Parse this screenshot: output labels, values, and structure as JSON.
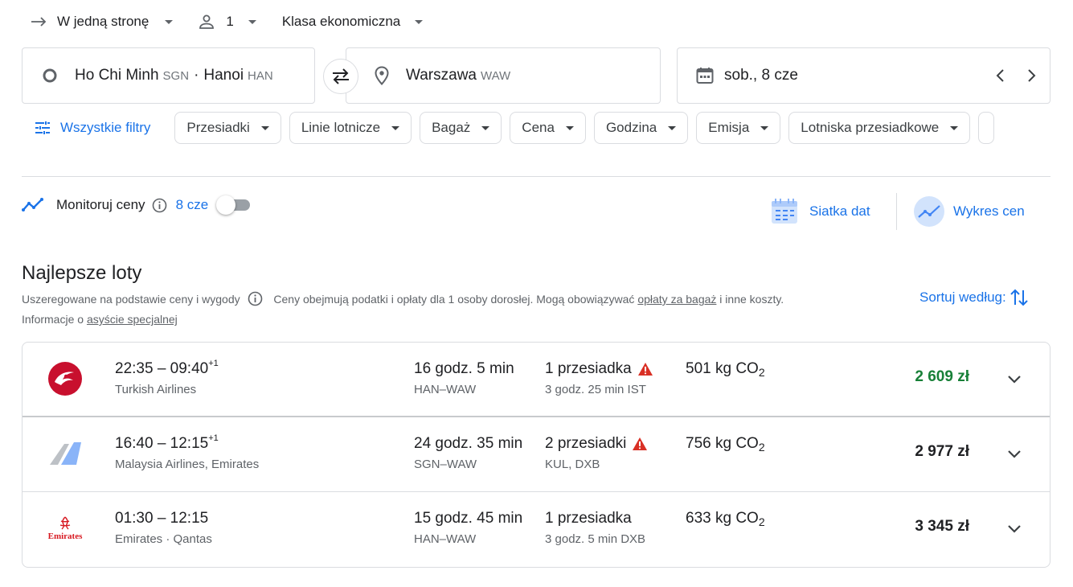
{
  "top": {
    "trip_type": "W jedną stronę",
    "passengers": "1",
    "cabin_class": "Klasa ekonomiczna"
  },
  "search": {
    "origin_city_1": "Ho Chi Minh",
    "origin_code_1": "SGN",
    "separator": "·",
    "origin_city_2": "Hanoi",
    "origin_code_2": "HAN",
    "destination_city": "Warszawa",
    "destination_code": "WAW",
    "date": "sob., 8 cze"
  },
  "filters": {
    "all_filters": "Wszystkie filtry",
    "chips": [
      "Przesiadki",
      "Linie lotnicze",
      "Bagaż",
      "Cena",
      "Godzina",
      "Emisja",
      "Lotniska przesiadkowe"
    ]
  },
  "monitor": {
    "label": "Monitoruj ceny",
    "date": "8 cze"
  },
  "views": {
    "date_grid": "Siatka dat",
    "price_graph": "Wykres cen"
  },
  "section": {
    "title": "Najlepsze loty",
    "ranked_by": "Uszeregowane na podstawie ceny i wygody",
    "prices_note_1": "Ceny obejmują podatki i opłaty dla 1 osoby dorosłej. Mogą obowiązywać",
    "baggage_link": "opłaty za bagaż",
    "prices_note_2": "i inne koszty.",
    "info_prefix": "Informacje o",
    "special_assistance_link": "asyście specjalnej",
    "sort_label": "Sortuj według:"
  },
  "flights": [
    {
      "times": "22:35 – 09:40",
      "day_offset": "+1",
      "airline": "Turkish Airlines",
      "duration": "16 godz. 5 min",
      "route": "HAN–WAW",
      "stops": "1 przesiadka",
      "stop_detail": "3 godz. 25 min IST",
      "co2_value": "501 kg CO",
      "co2_sub": "2",
      "price": "2 609 zł",
      "logo": "turkish-airlines-logo"
    },
    {
      "times": "16:40 – 12:15",
      "day_offset": "+1",
      "airline": "Malaysia Airlines, Emirates",
      "duration": "24 godz. 35 min",
      "route": "SGN–WAW",
      "stops": "2 przesiadki",
      "stop_detail": "KUL, DXB",
      "co2_value": "756 kg CO",
      "co2_sub": "2",
      "price": "2 977 zł",
      "logo": "multi-airline-logo"
    },
    {
      "times": "01:30 – 12:15",
      "day_offset": "",
      "airline": "Emirates · Qantas",
      "duration": "15 godz. 45 min",
      "route": "HAN–WAW",
      "stops": "1 przesiadka",
      "stop_detail": "3 godz. 5 min DXB",
      "co2_value": "633 kg CO",
      "co2_sub": "2",
      "price": "3 345 zł",
      "logo": "emirates-logo",
      "logo_text": "Emirates"
    }
  ],
  "colors": {
    "accent": "#1a73e8",
    "price_best": "#188038",
    "warning": "#d93025"
  }
}
